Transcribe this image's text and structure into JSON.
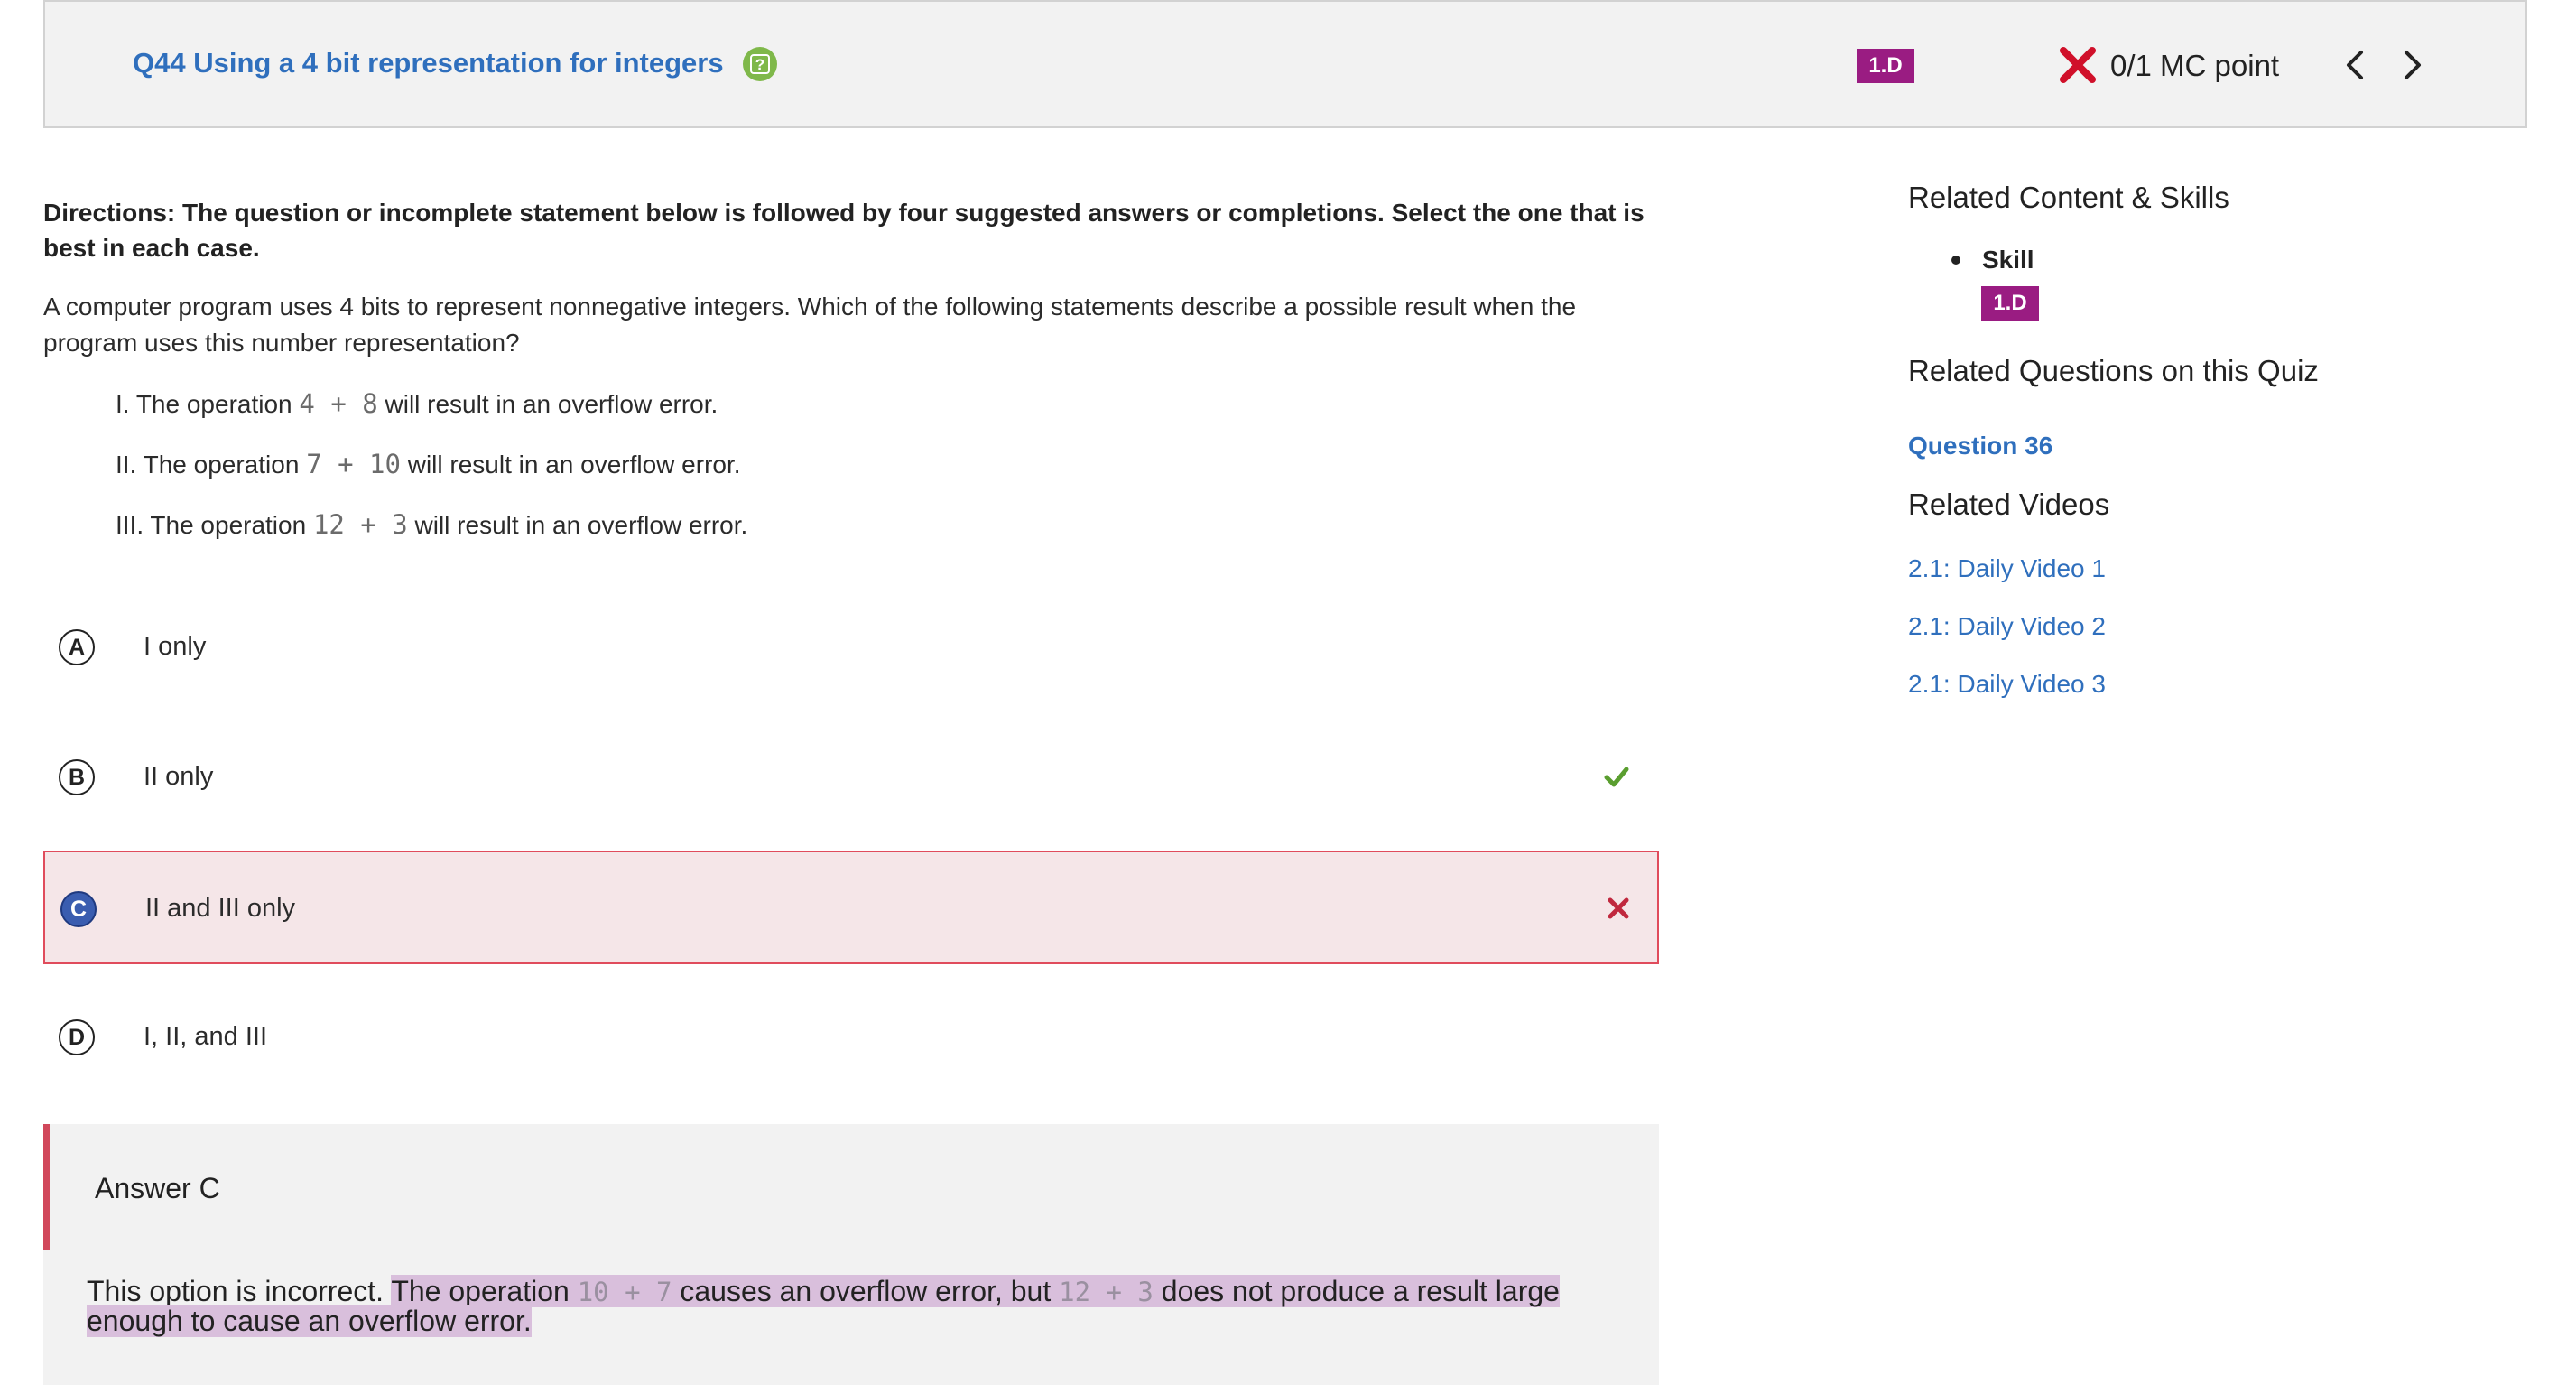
{
  "header": {
    "title": "Q44 Using a 4 bit representation for integers",
    "skill_badge": "1.D",
    "score": "0/1 MC point"
  },
  "colors": {
    "accent_link": "#2f6fbd",
    "skill_badge": "#9a1c82",
    "incorrect": "#e04c5c",
    "correct": "#5a9e2f"
  },
  "question": {
    "directions": "Directions: The question or incomplete statement below is followed by four suggested answers or completions. Select the one that is best in each case.",
    "prompt": "A computer program uses 4 bits to represent nonnegative integers. Which of the following statements describe a possible result when the program uses this number representation?",
    "statements": [
      {
        "prefix": "I. The operation",
        "code": "4 + 8",
        "suffix": "will result in an overflow error."
      },
      {
        "prefix": "II. The operation",
        "code": "7 + 10",
        "suffix": "will result in an overflow error."
      },
      {
        "prefix": "III. The operation",
        "code": "12 + 3",
        "suffix": "will result in an overflow error."
      }
    ]
  },
  "choices": [
    {
      "letter": "A",
      "text": "I only",
      "status": "none"
    },
    {
      "letter": "B",
      "text": "II only",
      "status": "correct"
    },
    {
      "letter": "C",
      "text": "II and III only",
      "status": "selected-incorrect"
    },
    {
      "letter": "D",
      "text": "I, II, and III",
      "status": "none"
    }
  ],
  "explanation": {
    "title": "Answer C",
    "intro": "This option is incorrect.",
    "part1": "The operation",
    "code1": "10 + 7",
    "part2": "causes an overflow error, but",
    "code2": "12 + 3",
    "part3": "does not produce a result large enough to cause an overflow error."
  },
  "sidebar": {
    "related_content_heading": "Related Content & Skills",
    "skill_label": "Skill",
    "skill_badge": "1.D",
    "related_questions_heading": "Related Questions on this Quiz",
    "related_question": "Question 36",
    "related_videos_heading": "Related Videos",
    "videos": [
      "2.1: Daily Video 1",
      "2.1: Daily Video 2",
      "2.1: Daily Video 3"
    ]
  },
  "icons": [
    "help-icon",
    "incorrect-x-icon",
    "chevron-left-icon",
    "chevron-right-icon",
    "checkmark-icon",
    "close-x-icon"
  ]
}
